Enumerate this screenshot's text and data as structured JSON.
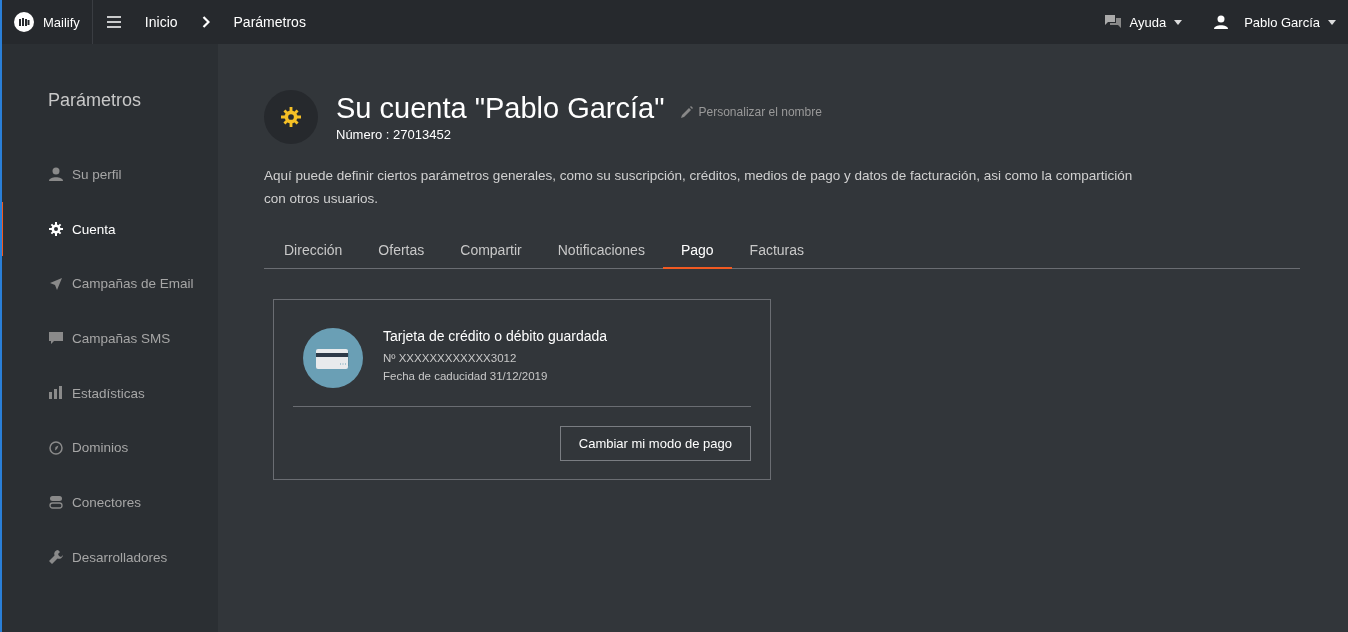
{
  "topbar": {
    "brand": "Mailify",
    "breadcrumb": [
      "Inicio",
      "Parámetros"
    ],
    "help": "Ayuda",
    "user": "Pablo García"
  },
  "sidebar": {
    "title": "Parámetros",
    "items": [
      {
        "label": "Su perfil",
        "kind": "user",
        "selected": false
      },
      {
        "label": "Cuenta",
        "kind": "gear",
        "selected": true
      },
      {
        "label": "Campañas de Email",
        "kind": "plane",
        "selected": false
      },
      {
        "label": "Campañas SMS",
        "kind": "chat",
        "selected": false
      },
      {
        "label": "Estadísticas",
        "kind": "bars",
        "selected": false
      },
      {
        "label": "Dominios",
        "kind": "compass",
        "selected": false
      },
      {
        "label": "Conectores",
        "kind": "toggle",
        "selected": false
      },
      {
        "label": "Desarrolladores",
        "kind": "wrench",
        "selected": false
      }
    ]
  },
  "account": {
    "title": "Su cuenta \"Pablo García\"",
    "rename": "Personalizar el nombre",
    "number": "Número : 27013452",
    "description": "Aquí puede definir ciertos parámetros generales, como su suscripción, créditos, medios de pago y datos de facturación, asi como la compartición con otros usuarios."
  },
  "tabs": [
    {
      "label": "Dirección",
      "selected": false
    },
    {
      "label": "Ofertas",
      "selected": false
    },
    {
      "label": "Compartir",
      "selected": false
    },
    {
      "label": "Notificaciones",
      "selected": false
    },
    {
      "label": "Pago",
      "selected": true
    },
    {
      "label": "Facturas",
      "selected": false
    }
  ],
  "payment": {
    "title": "Tarjeta de crédito o débito guardada",
    "card_number": "Nº XXXXXXXXXXXX3012",
    "expiry": "Fecha de caducidad 31/12/2019",
    "button": "Cambiar mi modo de pago"
  }
}
